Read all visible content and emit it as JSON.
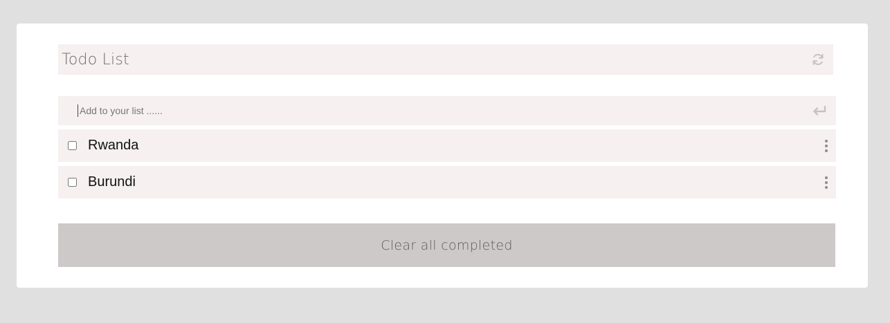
{
  "header": {
    "title": "Todo List",
    "refresh_icon": "refresh-icon"
  },
  "add": {
    "placeholder": "Add to your list ......",
    "value": "",
    "enter_icon": "enter-icon"
  },
  "todos": [
    {
      "text": "Rwanda",
      "completed": false,
      "menu_icon": "more-vertical-icon"
    },
    {
      "text": "Burundi",
      "completed": false,
      "menu_icon": "more-vertical-icon"
    }
  ],
  "footer": {
    "clear_label": "Clear all completed"
  },
  "colors": {
    "page_background": "#e0e0e0",
    "card_background": "#ffffff",
    "row_background": "#f6f0f0",
    "button_background": "#cdc9c8",
    "title_text": "#6f6a6a",
    "icon_gray": "#c7c2c2"
  }
}
